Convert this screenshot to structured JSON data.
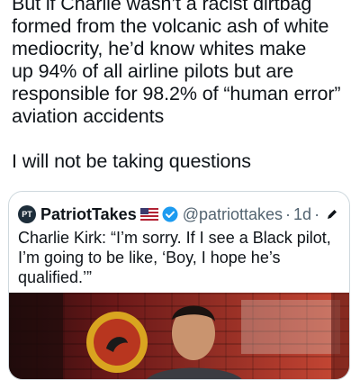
{
  "tweet": {
    "lines": [
      "But if Charlie wasn’t a racist dirtbag",
      "formed from the volcanic ash of white",
      "mediocrity, he’d know whites make",
      "up 94% of all airline pilots but are",
      "responsible for 98.2% of “human error”",
      "aviation accidents"
    ],
    "closing": "I will not be taking questions"
  },
  "quote": {
    "avatar_initials": "PT",
    "display_name": "PatriotTakes",
    "handle": "@patriottakes",
    "separator": "·",
    "time": "1d",
    "text_lines": [
      "Charlie Kirk: “I’m sorry. If I see a Black pilot,",
      "I’m going to be like, ‘Boy, I hope he’s",
      "qualified.’”"
    ],
    "icons": [
      "us-flag-icon",
      "verified-badge-icon",
      "pencil-icon"
    ]
  },
  "colors": {
    "text": "#0f1419",
    "secondary": "#536471",
    "border": "#cfd9de",
    "verified": "#1d9bf0"
  }
}
